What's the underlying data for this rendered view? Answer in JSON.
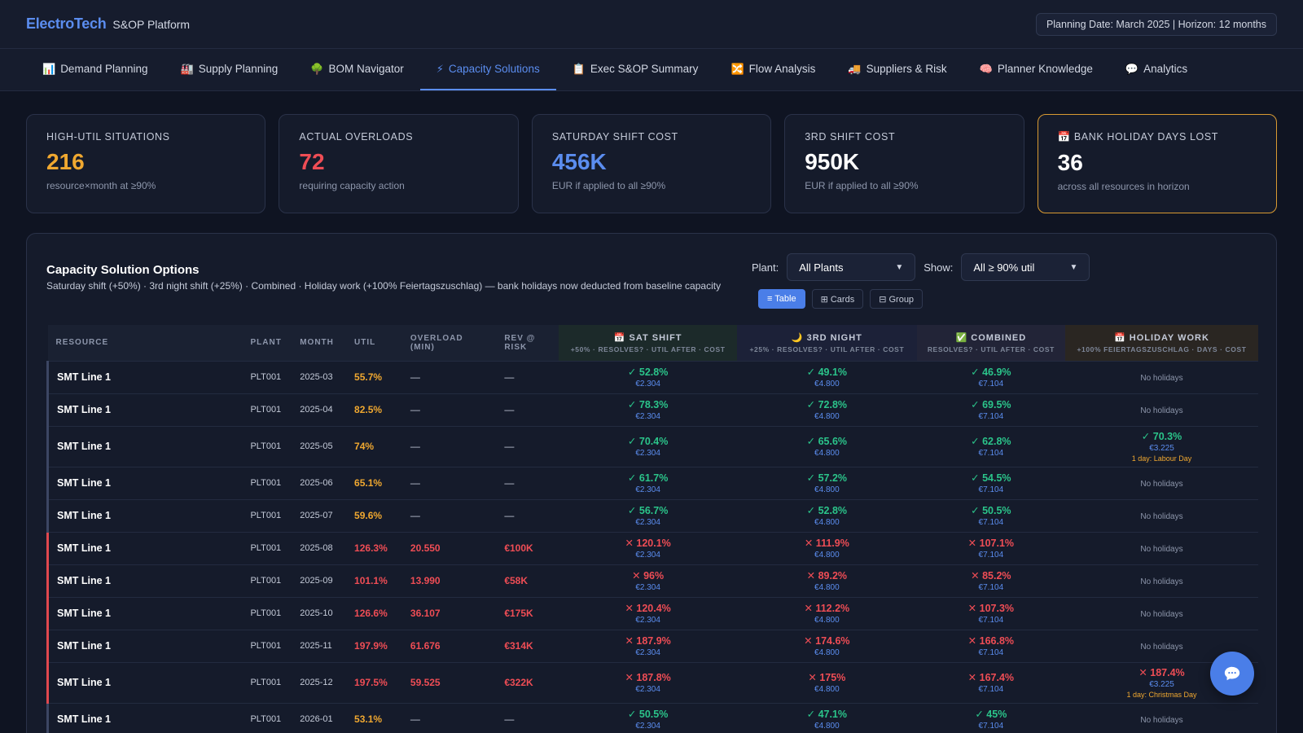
{
  "app": {
    "brand": "ElectroTech",
    "subtitle": "S&OP Platform",
    "planning": "Planning Date: March 2025  |  Horizon: 12 months"
  },
  "tabs": [
    {
      "icon": "📊",
      "label": "Demand Planning"
    },
    {
      "icon": "🏭",
      "label": "Supply Planning"
    },
    {
      "icon": "🌳",
      "label": "BOM Navigator"
    },
    {
      "icon": "⚡",
      "label": "Capacity Solutions"
    },
    {
      "icon": "📋",
      "label": "Exec S&OP Summary"
    },
    {
      "icon": "🔀",
      "label": "Flow Analysis"
    },
    {
      "icon": "🚚",
      "label": "Suppliers & Risk"
    },
    {
      "icon": "🧠",
      "label": "Planner Knowledge"
    },
    {
      "icon": "💬",
      "label": "Analytics"
    }
  ],
  "kpis": [
    {
      "label": "HIGH-UTIL SITUATIONS",
      "value": "216",
      "sub": "resource×month at ≥90%",
      "color": "#f0a830"
    },
    {
      "label": "ACTUAL OVERLOADS",
      "value": "72",
      "sub": "requiring capacity action",
      "color": "#ef4d55"
    },
    {
      "label": "SATURDAY SHIFT COST",
      "value": "456K",
      "sub": "EUR if applied to all ≥90%",
      "color": "#5b8def"
    },
    {
      "label": "3RD SHIFT COST",
      "value": "950K",
      "sub": "EUR if applied to all ≥90%",
      "color": "#ffffff"
    },
    {
      "label": "📅 BANK HOLIDAY DAYS LOST",
      "value": "36",
      "sub": "across all resources in horizon",
      "color": "#ffffff"
    }
  ],
  "panel": {
    "title": "Capacity Solution Options",
    "desc": "Saturday shift (+50%) · 3rd night shift (+25%) · Combined · Holiday work (+100% Feiertagszuschlag) — bank holidays now deducted from baseline capacity",
    "plant_label": "Plant:",
    "plant_value": "All Plants",
    "show_label": "Show:",
    "show_value": "All ≥ 90% util",
    "views": [
      "≡ Table",
      "⊞ Cards",
      "⊟ Group"
    ]
  },
  "table": {
    "headers": {
      "resource": "RESOURCE",
      "plant": "PLANT",
      "month": "MONTH",
      "util": "UTIL",
      "overload": "OVERLOAD (MIN)",
      "rev": "REV @ RISK",
      "sat_title": "📅 SAT SHIFT",
      "sat_sub": "+50% · RESOLVES? · UTIL AFTER · COST",
      "third_title": "🌙 3RD NIGHT",
      "third_sub": "+25% · RESOLVES? · UTIL AFTER · COST",
      "comb_title": "✅ COMBINED",
      "comb_sub": "RESOLVES? · UTIL AFTER · COST",
      "hol_title": "📅 HOLIDAY WORK",
      "hol_sub": "+100% FEIERTAGSZUSCHLAG · DAYS · COST"
    },
    "rows": [
      {
        "resource": "SMT Line 1",
        "plant": "PLT001",
        "month": "2025-03",
        "util": "55.7%",
        "overload": "—",
        "rev": "—",
        "sat": "✓ 52.8%",
        "sat_cost": "€2.304",
        "third": "✓ 49.1%",
        "third_cost": "€4.800",
        "comb": "✓ 46.9%",
        "comb_cost": "€7.104",
        "hol": "No holidays"
      },
      {
        "resource": "SMT Line 1",
        "plant": "PLT001",
        "month": "2025-04",
        "util": "82.5%",
        "overload": "—",
        "rev": "—",
        "sat": "✓ 78.3%",
        "sat_cost": "€2.304",
        "third": "✓ 72.8%",
        "third_cost": "€4.800",
        "comb": "✓ 69.5%",
        "comb_cost": "€7.104",
        "hol": "No holidays"
      },
      {
        "resource": "SMT Line 1",
        "plant": "PLT001",
        "month": "2025-05",
        "util": "74%",
        "overload": "—",
        "rev": "—",
        "sat": "✓ 70.4%",
        "sat_cost": "€2.304",
        "third": "✓ 65.6%",
        "third_cost": "€4.800",
        "comb": "✓ 62.8%",
        "comb_cost": "€7.104",
        "hol": "✓ 70.3%",
        "hol_cost": "€3.225",
        "hol_note": "1 day: Labour Day"
      },
      {
        "resource": "SMT Line 1",
        "plant": "PLT001",
        "month": "2025-06",
        "util": "65.1%",
        "overload": "—",
        "rev": "—",
        "sat": "✓ 61.7%",
        "sat_cost": "€2.304",
        "third": "✓ 57.2%",
        "third_cost": "€4.800",
        "comb": "✓ 54.5%",
        "comb_cost": "€7.104",
        "hol": "No holidays"
      },
      {
        "resource": "SMT Line 1",
        "plant": "PLT001",
        "month": "2025-07",
        "util": "59.6%",
        "overload": "—",
        "rev": "—",
        "sat": "✓ 56.7%",
        "sat_cost": "€2.304",
        "third": "✓ 52.8%",
        "third_cost": "€4.800",
        "comb": "✓ 50.5%",
        "comb_cost": "€7.104",
        "hol": "No holidays"
      },
      {
        "resource": "SMT Line 1",
        "plant": "PLT001",
        "month": "2025-08",
        "util": "126.3%",
        "overload": "20.550",
        "rev": "€100K",
        "sat": "✕ 120.1%",
        "sat_cost": "€2.304",
        "third": "✕ 111.9%",
        "third_cost": "€4.800",
        "comb": "✕ 107.1%",
        "comb_cost": "€7.104",
        "hol": "No holidays"
      },
      {
        "resource": "SMT Line 1",
        "plant": "PLT001",
        "month": "2025-09",
        "util": "101.1%",
        "overload": "13.990",
        "rev": "€58K",
        "sat": "✕ 96%",
        "sat_cost": "€2.304",
        "third": "✕ 89.2%",
        "third_cost": "€4.800",
        "comb": "✕ 85.2%",
        "comb_cost": "€7.104",
        "hol": "No holidays"
      },
      {
        "resource": "SMT Line 1",
        "plant": "PLT001",
        "month": "2025-10",
        "util": "126.6%",
        "overload": "36.107",
        "rev": "€175K",
        "sat": "✕ 120.4%",
        "sat_cost": "€2.304",
        "third": "✕ 112.2%",
        "third_cost": "€4.800",
        "comb": "✕ 107.3%",
        "comb_cost": "€7.104",
        "hol": "No holidays"
      },
      {
        "resource": "SMT Line 1",
        "plant": "PLT001",
        "month": "2025-11",
        "util": "197.9%",
        "overload": "61.676",
        "rev": "€314K",
        "sat": "✕ 187.9%",
        "sat_cost": "€2.304",
        "third": "✕ 174.6%",
        "third_cost": "€4.800",
        "comb": "✕ 166.8%",
        "comb_cost": "€7.104",
        "hol": "No holidays"
      },
      {
        "resource": "SMT Line 1",
        "plant": "PLT001",
        "month": "2025-12",
        "util": "197.5%",
        "overload": "59.525",
        "rev": "€322K",
        "sat": "✕ 187.8%",
        "sat_cost": "€2.304",
        "third": "✕ 175%",
        "third_cost": "€4.800",
        "comb": "✕ 167.4%",
        "comb_cost": "€7.104",
        "hol": "✕ 187.4%",
        "hol_cost": "€3.225",
        "hol_note": "1 day: Christmas Day"
      },
      {
        "resource": "SMT Line 1",
        "plant": "PLT001",
        "month": "2026-01",
        "util": "53.1%",
        "overload": "—",
        "rev": "—",
        "sat": "✓ 50.5%",
        "sat_cost": "€2.304",
        "third": "✓ 47.1%",
        "third_cost": "€4.800",
        "comb": "✓ 45%",
        "comb_cost": "€7.104",
        "hol": "No holidays"
      }
    ]
  }
}
